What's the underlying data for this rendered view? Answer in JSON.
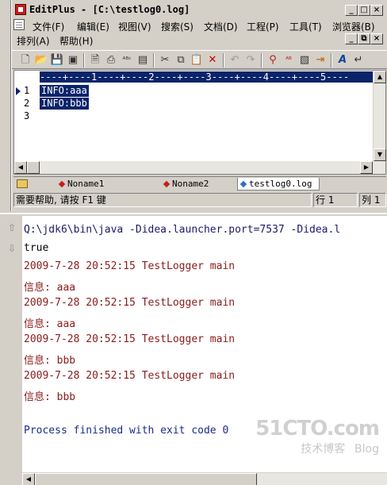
{
  "window": {
    "title": "EditPlus - [C:\\testlog0.log]",
    "controls": {
      "minimize": "_",
      "maximize": "□",
      "close": "×",
      "restore": "⧉"
    }
  },
  "menu": {
    "row1": [
      "文件(F)",
      "编辑(E)",
      "视图(V)",
      "搜索(S)",
      "文档(D)",
      "工程(P)",
      "工具(T)",
      "浏览器(B)"
    ],
    "row2": [
      "排列(A)",
      "帮助(H)"
    ]
  },
  "toolbar": {
    "icons": [
      "new-file-icon",
      "open-folder-icon",
      "save-icon",
      "save-all-icon",
      "print-preview-icon",
      "print-icon",
      "spellcheck-icon",
      "browser-view-icon",
      "cut-icon",
      "copy-icon",
      "paste-icon",
      "delete-icon",
      "undo-icon",
      "redo-icon",
      "find-icon",
      "replace-icon",
      "paste-special-icon",
      "goto-icon",
      "font-icon",
      "word-wrap-icon"
    ]
  },
  "editor": {
    "ruler": "----+----1----+----2----+----3----+----4----+----5----",
    "line_numbers": [
      "1",
      "2",
      "3"
    ],
    "lines": [
      "INFO:aaa",
      "INFO:bbb",
      ""
    ]
  },
  "tabs": [
    {
      "label": "Noname1",
      "active": false
    },
    {
      "label": "Noname2",
      "active": false
    },
    {
      "label": "testlog0.log",
      "active": true
    }
  ],
  "status": {
    "help": "需要帮助, 请按 F1 键",
    "row": "行 1",
    "col": "列 1"
  },
  "console": {
    "lines": [
      {
        "type": "cmd",
        "text": "Q:\\jdk6\\bin\\java -Didea.launcher.port=7537 -Didea.l"
      },
      {
        "type": "out",
        "text": "true"
      },
      {
        "type": "err",
        "text": "2009-7-28 20:52:15 TestLogger main"
      },
      {
        "type": "err",
        "text": "信息: aaa"
      },
      {
        "type": "err",
        "text": "2009-7-28 20:52:15 TestLogger main"
      },
      {
        "type": "err",
        "text": "信息: aaa"
      },
      {
        "type": "err",
        "text": "2009-7-28 20:52:15 TestLogger main"
      },
      {
        "type": "err",
        "text": "信息: bbb"
      },
      {
        "type": "err",
        "text": "2009-7-28 20:52:15 TestLogger main"
      },
      {
        "type": "err",
        "text": "信息: bbb"
      },
      {
        "type": "blank",
        "text": ""
      },
      {
        "type": "exit",
        "text": "Process finished with exit code 0"
      }
    ]
  },
  "watermark": {
    "brand": "51CTO.com",
    "sub": "技术博客",
    "blog": "Blog"
  }
}
